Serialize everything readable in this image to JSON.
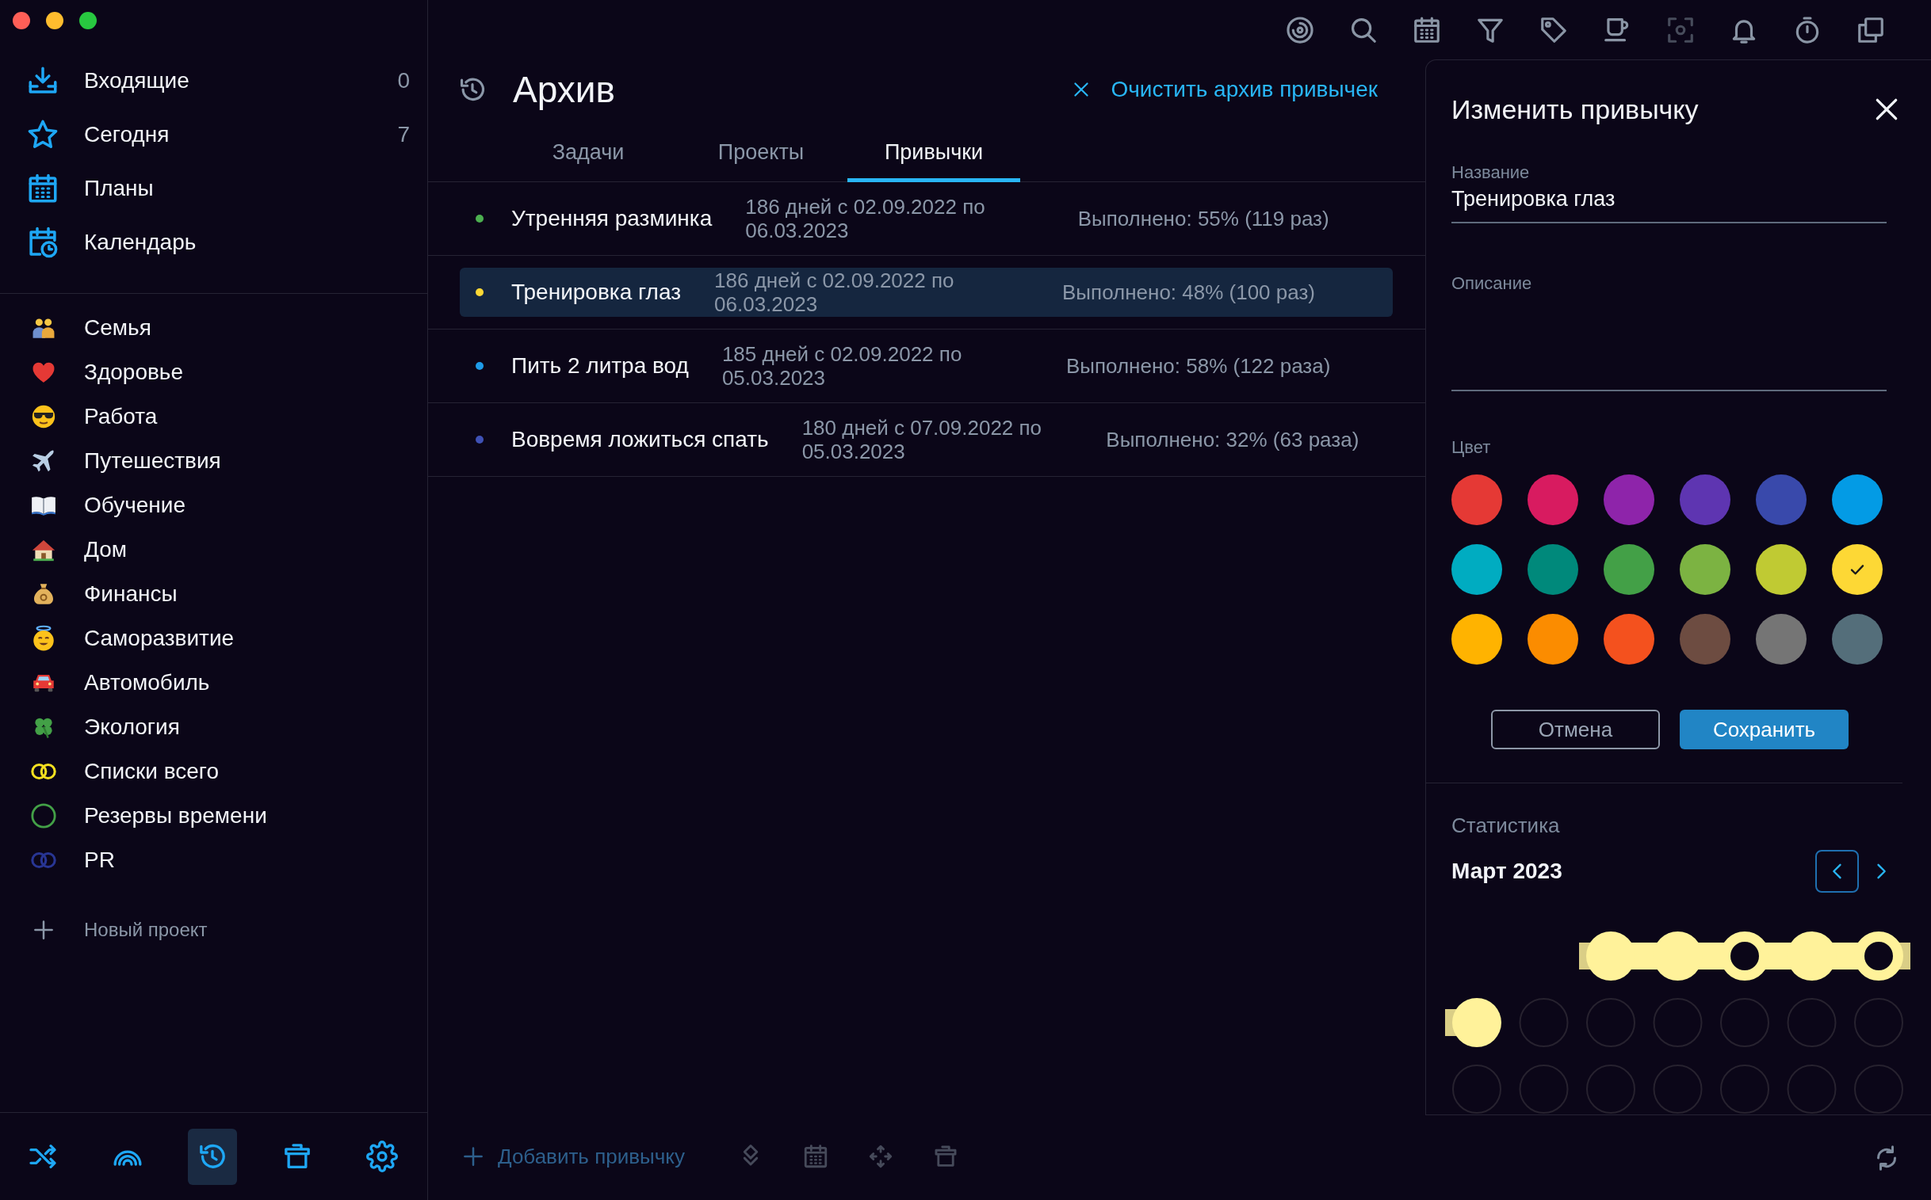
{
  "window": {
    "controls": [
      {
        "color": "#fe5f57"
      },
      {
        "color": "#febc2e"
      },
      {
        "color": "#28c840"
      }
    ]
  },
  "sidebar": {
    "nav": [
      {
        "kind": "inbox",
        "label": "Входящие",
        "count": "0"
      },
      {
        "kind": "star",
        "label": "Сегодня",
        "count": "7"
      },
      {
        "kind": "plans",
        "label": "Планы"
      },
      {
        "kind": "calendar_clock",
        "label": "Календарь"
      }
    ],
    "projects": [
      {
        "kind": "family",
        "label": "Семья"
      },
      {
        "kind": "heart",
        "label": "Здоровье"
      },
      {
        "kind": "cool",
        "label": "Работа"
      },
      {
        "kind": "plane",
        "label": "Путешествия"
      },
      {
        "kind": "book",
        "label": "Обучение"
      },
      {
        "kind": "house",
        "label": "Дом"
      },
      {
        "kind": "money",
        "label": "Финансы"
      },
      {
        "kind": "halo",
        "label": "Саморазвитие"
      },
      {
        "kind": "car",
        "label": "Автомобиль"
      },
      {
        "kind": "clover",
        "label": "Экология"
      },
      {
        "kind": "rings",
        "label": "Списки всего",
        "color": "#f5e020"
      },
      {
        "kind": "ring",
        "label": "Резервы времени",
        "color": "#43a047"
      },
      {
        "kind": "rings",
        "label": "PR",
        "color": "#283593"
      }
    ],
    "new_project": "Новый проект",
    "bottom_bar": [
      {
        "kind": "shuffle",
        "selected": false
      },
      {
        "kind": "rainbow",
        "selected": false
      },
      {
        "kind": "history",
        "selected": true
      },
      {
        "kind": "box",
        "selected": false
      },
      {
        "kind": "gear",
        "selected": false
      }
    ]
  },
  "toolbar": [
    {
      "kind": "radar",
      "disabled": false
    },
    {
      "kind": "search",
      "disabled": false
    },
    {
      "kind": "plans",
      "disabled": false
    },
    {
      "kind": "filter",
      "disabled": false
    },
    {
      "kind": "tag",
      "disabled": false
    },
    {
      "kind": "cup",
      "disabled": false
    },
    {
      "kind": "focus",
      "disabled": true
    },
    {
      "kind": "bell",
      "disabled": false
    },
    {
      "kind": "timer",
      "disabled": false
    },
    {
      "kind": "copy",
      "disabled": false
    }
  ],
  "archive": {
    "title": "Архив",
    "clear_action": "Очистить архив привычек",
    "tabs": [
      {
        "label": "Задачи",
        "selected": false
      },
      {
        "label": "Проекты",
        "selected": false
      },
      {
        "label": "Привычки",
        "selected": true
      }
    ],
    "habits": [
      {
        "name": "Утренняя разминка",
        "color": "#4caf50",
        "period": "186 дней с 02.09.2022 по 06.03.2023",
        "done": "Выполнено: 55% (119 раз)",
        "selected": false
      },
      {
        "name": "Тренировка глаз",
        "color": "#fdd835",
        "period": "186 дней с 02.09.2022 по 06.03.2023",
        "done": "Выполнено: 48% (100 раз)",
        "selected": true
      },
      {
        "name": "Пить 2 литра вод",
        "color": "#1e9be8",
        "period": "185 дней с 02.09.2022 по 05.03.2023",
        "done": "Выполнено: 58% (122 раза)",
        "selected": false
      },
      {
        "name": "Вовремя ложиться спать",
        "color": "#3f51b5",
        "period": "180 дней с 07.09.2022 по 05.03.2023",
        "done": "Выполнено: 32% (63 раза)",
        "selected": false
      }
    ],
    "add_habit": "Добавить привычку",
    "actions": [
      {
        "kind": "layers"
      },
      {
        "kind": "plans"
      },
      {
        "kind": "move"
      },
      {
        "kind": "box"
      }
    ]
  },
  "editor": {
    "title": "Изменить привычку",
    "name_field": {
      "label": "Название",
      "value": "Тренировка глаз"
    },
    "description_field": {
      "label": "Описание"
    },
    "color_label": "Цвет",
    "swatches": [
      {
        "color": "#e53935",
        "selected": false
      },
      {
        "color": "#d81b60",
        "selected": false
      },
      {
        "color": "#8e24aa",
        "selected": false
      },
      {
        "color": "#5e35b1",
        "selected": false
      },
      {
        "color": "#3949ab",
        "selected": false
      },
      {
        "color": "#039be5",
        "selected": false
      },
      {
        "color": "#00acc1",
        "selected": false
      },
      {
        "color": "#00897b",
        "selected": false
      },
      {
        "color": "#43a047",
        "selected": false
      },
      {
        "color": "#7cb342",
        "selected": false
      },
      {
        "color": "#c0ca33",
        "selected": false
      },
      {
        "color": "#fdd835",
        "selected": true
      },
      {
        "color": "#ffb300",
        "selected": false
      },
      {
        "color": "#fb8c00",
        "selected": false
      },
      {
        "color": "#f4511e",
        "selected": false
      },
      {
        "color": "#6d4c41",
        "selected": false
      },
      {
        "color": "#757575",
        "selected": false
      },
      {
        "color": "#546e7a",
        "selected": false
      }
    ],
    "cancel": "Отмена",
    "save": "Сохранить"
  },
  "stats": {
    "title": "Статистика",
    "month": "Март 2023",
    "nav": [
      {
        "kind": "prev",
        "focused": true
      },
      {
        "kind": "next",
        "focused": false
      }
    ],
    "weeks": [
      {
        "days": [
          {
            "kind": "blank"
          },
          {
            "kind": "blank"
          },
          {
            "kind": "done"
          },
          {
            "kind": "done"
          },
          {
            "kind": "missed"
          },
          {
            "kind": "done"
          },
          {
            "kind": "missed"
          }
        ]
      },
      {
        "days": [
          {
            "kind": "done"
          },
          {
            "kind": "future"
          },
          {
            "kind": "future"
          },
          {
            "kind": "future"
          },
          {
            "kind": "future"
          },
          {
            "kind": "future"
          },
          {
            "kind": "future"
          }
        ]
      },
      {
        "days": [
          {
            "kind": "future"
          },
          {
            "kind": "future"
          },
          {
            "kind": "future"
          },
          {
            "kind": "future"
          },
          {
            "kind": "future"
          },
          {
            "kind": "future"
          },
          {
            "kind": "future"
          }
        ]
      }
    ]
  }
}
